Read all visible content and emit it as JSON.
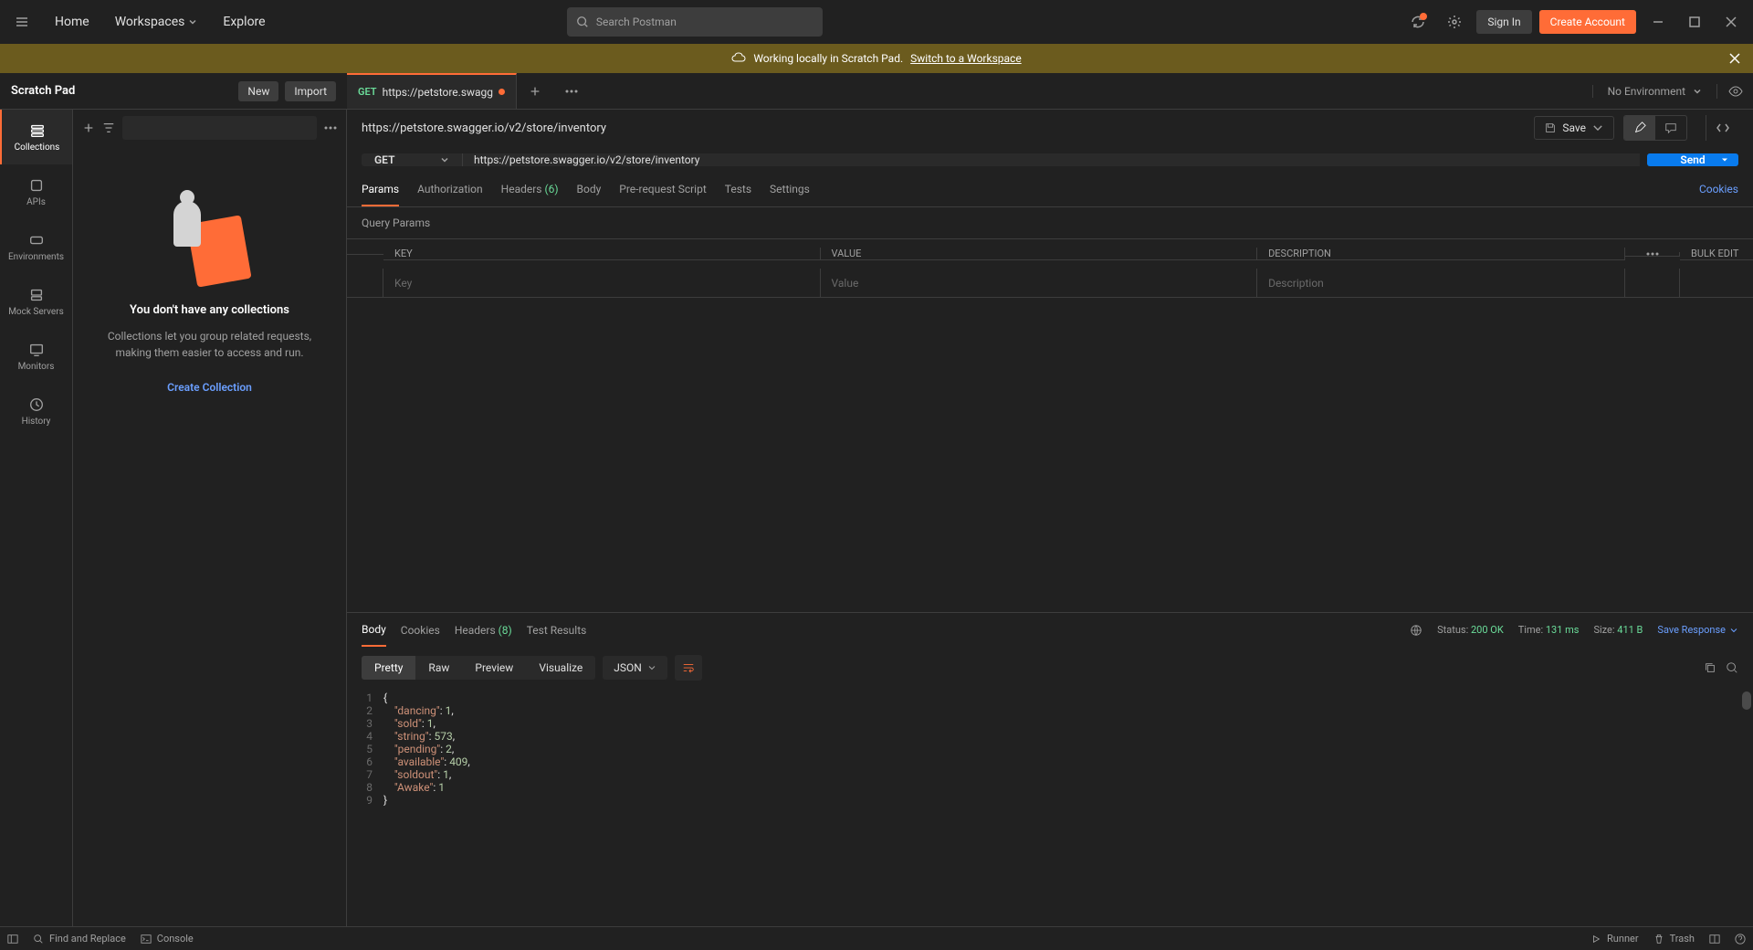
{
  "topbar": {
    "home": "Home",
    "workspaces": "Workspaces",
    "explore": "Explore",
    "search_placeholder": "Search Postman",
    "sign_in": "Sign In",
    "create_account": "Create Account"
  },
  "banner": {
    "text": "Working locally in Scratch Pad.",
    "link": "Switch to a Workspace"
  },
  "subheader": {
    "title": "Scratch Pad",
    "new_btn": "New",
    "import_btn": "Import",
    "tab_method": "GET",
    "tab_label": "https://petstore.swagg",
    "env_label": "No Environment"
  },
  "rail": {
    "items": [
      {
        "label": "Collections"
      },
      {
        "label": "APIs"
      },
      {
        "label": "Environments"
      },
      {
        "label": "Mock Servers"
      },
      {
        "label": "Monitors"
      },
      {
        "label": "History"
      }
    ]
  },
  "panel": {
    "empty_title": "You don't have any collections",
    "empty_sub": "Collections let you group related requests, making them easier to access and run.",
    "create_link": "Create Collection"
  },
  "request": {
    "breadcrumb": "https://petstore.swagger.io/v2/store/inventory",
    "save": "Save",
    "method": "GET",
    "url": "https://petstore.swagger.io/v2/store/inventory",
    "send": "Send",
    "tabs": {
      "params": "Params",
      "auth": "Authorization",
      "headers": "Headers",
      "headers_count": "(6)",
      "body": "Body",
      "pre": "Pre-request Script",
      "tests": "Tests",
      "settings": "Settings"
    },
    "cookies": "Cookies",
    "query_params_label": "Query Params",
    "table_headers": {
      "key": "KEY",
      "value": "VALUE",
      "desc": "DESCRIPTION"
    },
    "table_placeholders": {
      "key": "Key",
      "value": "Value",
      "desc": "Description"
    },
    "bulk_edit": "Bulk Edit"
  },
  "response": {
    "tabs": {
      "body": "Body",
      "cookies": "Cookies",
      "headers": "Headers",
      "headers_count": "(8)",
      "test_results": "Test Results"
    },
    "status_label": "Status:",
    "status_value": "200 OK",
    "time_label": "Time:",
    "time_value": "131 ms",
    "size_label": "Size:",
    "size_value": "411 B",
    "save_response": "Save Response",
    "view": {
      "pretty": "Pretty",
      "raw": "Raw",
      "preview": "Preview",
      "visualize": "Visualize"
    },
    "format": "JSON",
    "body_lines": [
      {
        "n": 1,
        "type": "open"
      },
      {
        "n": 2,
        "key": "\"dancing\"",
        "val": "1",
        "comma": true
      },
      {
        "n": 3,
        "key": "\"sold\"",
        "val": "1",
        "comma": true
      },
      {
        "n": 4,
        "key": "\"string\"",
        "val": "573",
        "comma": true
      },
      {
        "n": 5,
        "key": "\"pending\"",
        "val": "2",
        "comma": true
      },
      {
        "n": 6,
        "key": "\"available\"",
        "val": "409",
        "comma": true
      },
      {
        "n": 7,
        "key": "\"soldout\"",
        "val": "1",
        "comma": true
      },
      {
        "n": 8,
        "key": "\"Awake\"",
        "val": "1",
        "comma": false
      },
      {
        "n": 9,
        "type": "close"
      }
    ]
  },
  "bottombar": {
    "find": "Find and Replace",
    "console": "Console",
    "runner": "Runner",
    "trash": "Trash"
  }
}
